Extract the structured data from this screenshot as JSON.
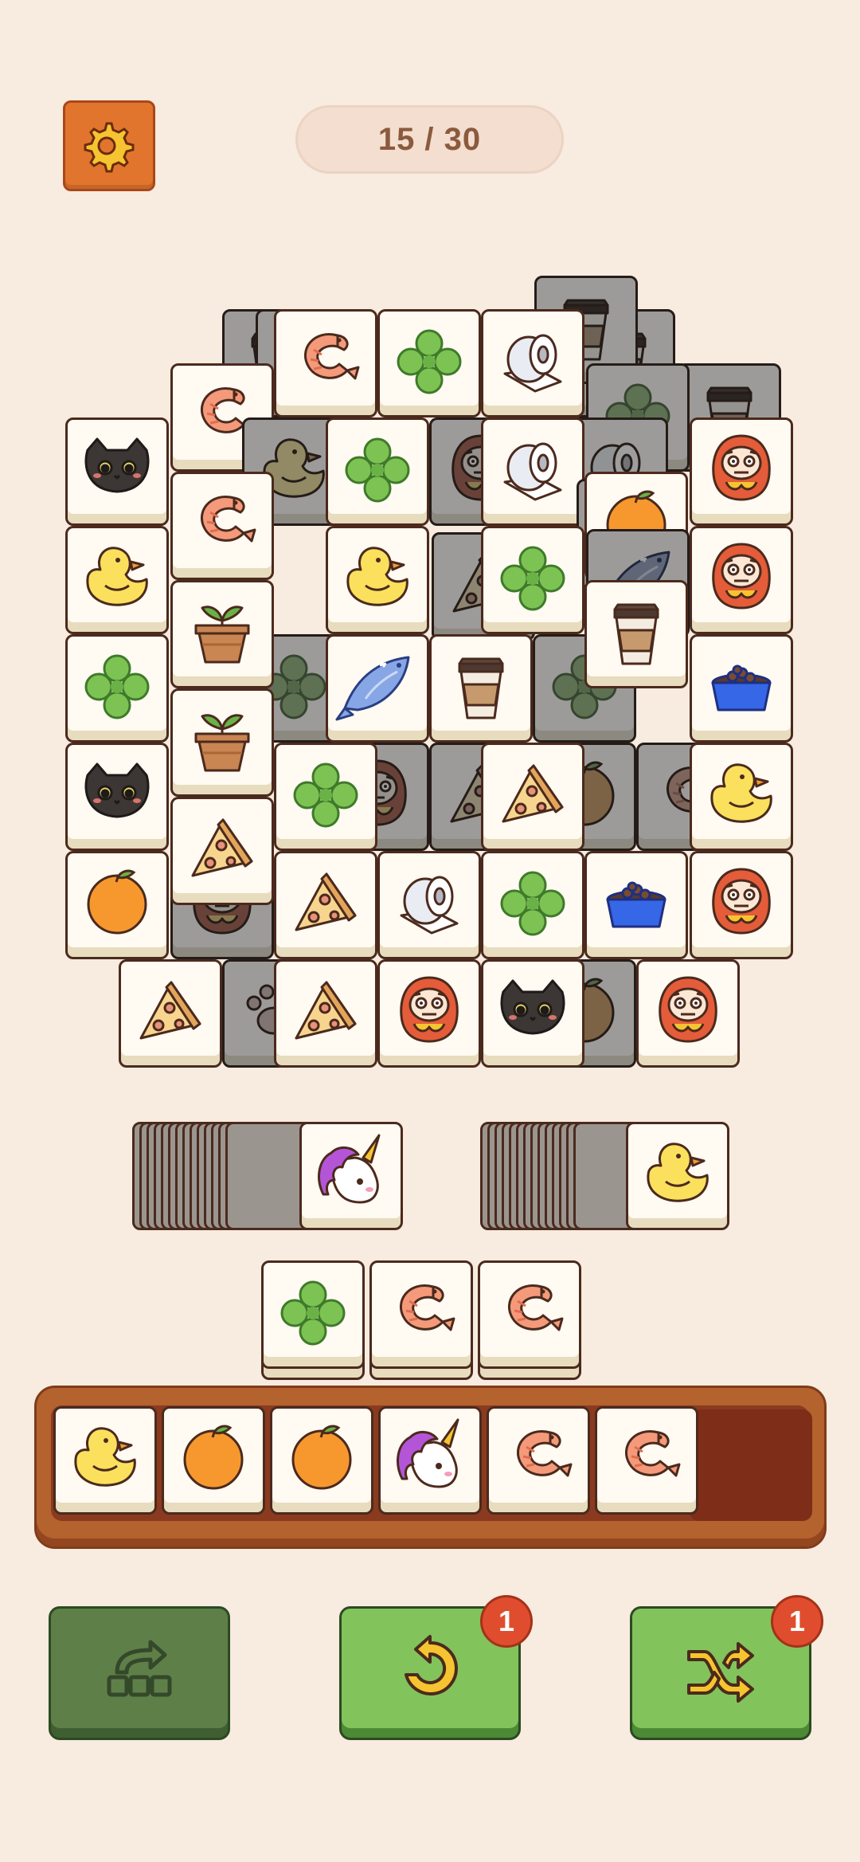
{
  "header": {
    "settings_icon": "gear-icon",
    "progress_text": "15 / 30",
    "progress_current": 15,
    "progress_total": 30
  },
  "colors": {
    "background": "#f8ebdf",
    "settings_button": "#e2752d",
    "tray": "#b4622e",
    "action_green": "#82c35c",
    "action_disabled": "#5f7f49",
    "badge_red": "#e04d2e"
  },
  "board": {
    "tiles": [
      {
        "icon": "coffee-icon",
        "dim": true
      },
      {
        "icon": "fish-icon",
        "dim": true
      },
      {
        "icon": "coffee-icon",
        "dim": true
      },
      {
        "icon": "coffee-icon",
        "dim": true
      },
      {
        "icon": "coffee-icon",
        "dim": true
      },
      {
        "icon": "clover-icon",
        "dim": true
      },
      {
        "icon": "shrimp-icon",
        "dim": false
      },
      {
        "icon": "clover-icon",
        "dim": false
      },
      {
        "icon": "toilet-paper-icon",
        "dim": false
      },
      {
        "icon": "shrimp-icon",
        "dim": false
      },
      {
        "icon": "duck-icon",
        "dim": true
      },
      {
        "icon": "daruma-icon",
        "dim": true
      },
      {
        "icon": "pizza-icon",
        "dim": true
      },
      {
        "icon": "toilet-paper-icon",
        "dim": true
      },
      {
        "icon": "cat-icon",
        "dim": false
      },
      {
        "icon": "clover-icon",
        "dim": false
      },
      {
        "icon": "toilet-paper-icon",
        "dim": false
      },
      {
        "icon": "daruma-icon",
        "dim": false
      },
      {
        "icon": "toilet-paper-icon",
        "dim": true
      },
      {
        "icon": "pizza-icon",
        "dim": true
      },
      {
        "icon": "shrimp-icon",
        "dim": false
      },
      {
        "icon": "orange-icon",
        "dim": false
      },
      {
        "icon": "duck-icon",
        "dim": false
      },
      {
        "icon": "duck-icon",
        "dim": false
      },
      {
        "icon": "clover-icon",
        "dim": false
      },
      {
        "icon": "daruma-icon",
        "dim": false
      },
      {
        "icon": "clover-icon",
        "dim": true
      },
      {
        "icon": "clover-icon",
        "dim": true
      },
      {
        "icon": "fish-icon",
        "dim": true
      },
      {
        "icon": "plant-pot-icon",
        "dim": false
      },
      {
        "icon": "coffee-icon",
        "dim": false
      },
      {
        "icon": "clover-icon",
        "dim": false
      },
      {
        "icon": "fish-icon",
        "dim": false
      },
      {
        "icon": "coffee-icon",
        "dim": false
      },
      {
        "icon": "pet-bowl-icon",
        "dim": false
      },
      {
        "icon": "daruma-icon",
        "dim": true
      },
      {
        "icon": "pizza-icon",
        "dim": true
      },
      {
        "icon": "orange-icon",
        "dim": true
      },
      {
        "icon": "shrimp-icon",
        "dim": true
      },
      {
        "icon": "plant-pot-icon",
        "dim": false
      },
      {
        "icon": "cat-icon",
        "dim": false
      },
      {
        "icon": "clover-icon",
        "dim": false
      },
      {
        "icon": "pizza-icon",
        "dim": false
      },
      {
        "icon": "duck-icon",
        "dim": false
      },
      {
        "icon": "daruma-icon",
        "dim": true
      },
      {
        "icon": "pizza-icon",
        "dim": false
      },
      {
        "icon": "orange-icon",
        "dim": false
      },
      {
        "icon": "pizza-icon",
        "dim": false
      },
      {
        "icon": "toilet-paper-icon",
        "dim": false
      },
      {
        "icon": "clover-icon",
        "dim": false
      },
      {
        "icon": "pet-bowl-icon",
        "dim": false
      },
      {
        "icon": "daruma-icon",
        "dim": false
      },
      {
        "icon": "paw-icon",
        "dim": true
      },
      {
        "icon": "orange-icon",
        "dim": true
      },
      {
        "icon": "pizza-icon",
        "dim": false
      },
      {
        "icon": "pizza-icon",
        "dim": false
      },
      {
        "icon": "daruma-icon",
        "dim": false
      },
      {
        "icon": "cat-icon",
        "dim": false
      },
      {
        "icon": "daruma-icon",
        "dim": false
      }
    ]
  },
  "stacks": {
    "left": {
      "top_icon": "unicorn-icon"
    },
    "right": {
      "top_icon": "duck-icon"
    }
  },
  "staging": [
    {
      "icon": "clover-icon"
    },
    {
      "icon": "shrimp-icon"
    },
    {
      "icon": "shrimp-icon"
    }
  ],
  "tray": {
    "slots": [
      {
        "icon": "duck-icon"
      },
      {
        "icon": "orange-icon"
      },
      {
        "icon": "orange-icon"
      },
      {
        "icon": "unicorn-icon"
      },
      {
        "icon": "shrimp-icon"
      },
      {
        "icon": "shrimp-icon"
      }
    ],
    "empty_slots": 1
  },
  "actions": {
    "return": {
      "icon": "return-tiles-icon",
      "enabled": false
    },
    "undo": {
      "icon": "undo-icon",
      "badge": "1",
      "enabled": true
    },
    "shuffle": {
      "icon": "shuffle-icon",
      "badge": "1",
      "enabled": true
    }
  }
}
